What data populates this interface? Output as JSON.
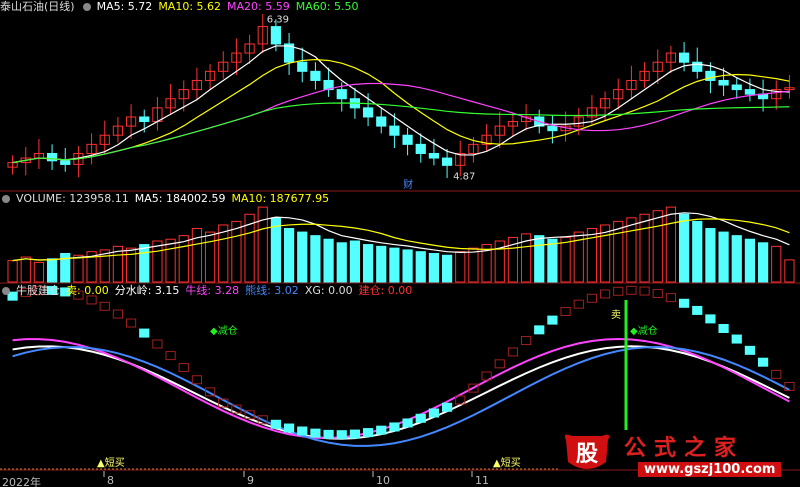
{
  "top_panel": {
    "title": "泰山石油(日线)",
    "ma": [
      {
        "label": "MA5: 5.72",
        "color": "#ffffff"
      },
      {
        "label": "MA10: 5.62",
        "color": "#ffff00"
      },
      {
        "label": "MA20: 5.59",
        "color": "#ff44ff"
      },
      {
        "label": "MA60: 5.50",
        "color": "#33ff33"
      }
    ],
    "high_marker": "6.39",
    "low_marker": "4.87",
    "event_marker": "财"
  },
  "volume_panel": {
    "labels": [
      {
        "label": "VOLUME: 123958.11",
        "color": "#dddddd"
      },
      {
        "label": "MA5: 184002.59",
        "color": "#ffffff"
      },
      {
        "label": "MA10: 187677.95",
        "color": "#ffff00"
      }
    ]
  },
  "indicator_panel": {
    "name": "牛股建仓",
    "values": [
      {
        "label": "卖: 0.00",
        "color": "#ffff00"
      },
      {
        "label": "分水岭: 3.15",
        "color": "#ffffff"
      },
      {
        "label": "牛线: 3.28",
        "color": "#ff44ff"
      },
      {
        "label": "熊线: 3.02",
        "color": "#4488ff"
      },
      {
        "label": "XG: 0.00",
        "color": "#dddddd"
      },
      {
        "label": "建仓: 0.00",
        "color": "#ff3333"
      }
    ],
    "signals": {
      "buy1": "▲短买",
      "buy2": "▲短买",
      "reduce1": "◆减仓",
      "reduce2": "◆减仓",
      "sell": "卖"
    }
  },
  "x_axis": {
    "labels": [
      "2022年",
      "8",
      "9",
      "10",
      "11"
    ]
  },
  "watermark": {
    "badge": "股",
    "text": "公式之家",
    "url": "www.gszj100.com"
  },
  "chart_data": [
    {
      "type": "candlestick",
      "title": "泰山石油(日线)",
      "high": 6.39,
      "low": 4.87,
      "close_series": [
        4.9,
        4.95,
        5.0,
        4.92,
        4.88,
        5.0,
        5.1,
        5.2,
        5.3,
        5.4,
        5.35,
        5.5,
        5.6,
        5.7,
        5.8,
        5.9,
        6.0,
        6.1,
        6.2,
        6.39,
        6.2,
        6.0,
        5.9,
        5.8,
        5.7,
        5.6,
        5.5,
        5.4,
        5.3,
        5.2,
        5.1,
        5.0,
        4.95,
        4.87,
        5.0,
        5.1,
        5.2,
        5.3,
        5.35,
        5.4,
        5.3,
        5.25,
        5.3,
        5.4,
        5.5,
        5.6,
        5.7,
        5.8,
        5.9,
        6.0,
        6.1,
        6.0,
        5.9,
        5.8,
        5.75,
        5.7,
        5.65,
        5.6,
        5.7,
        5.72
      ],
      "ma": {
        "MA5": 5.72,
        "MA10": 5.62,
        "MA20": 5.59,
        "MA60": 5.5
      }
    },
    {
      "type": "bar",
      "title": "VOLUME",
      "last_value": 123958.11,
      "ma": {
        "MA5": 184002.59,
        "MA10": 187677.95
      },
      "values": [
        120,
        140,
        110,
        130,
        160,
        150,
        170,
        180,
        200,
        190,
        210,
        230,
        240,
        260,
        300,
        280,
        320,
        340,
        380,
        420,
        360,
        300,
        280,
        260,
        240,
        220,
        230,
        210,
        200,
        190,
        180,
        170,
        160,
        150,
        170,
        190,
        210,
        230,
        250,
        270,
        260,
        240,
        250,
        280,
        300,
        320,
        340,
        360,
        380,
        400,
        420,
        380,
        340,
        300,
        280,
        260,
        240,
        220,
        200,
        124
      ]
    },
    {
      "type": "line",
      "title": "牛股建仓",
      "series": [
        {
          "name": "分水岭",
          "last": 3.15,
          "color": "#ffffff"
        },
        {
          "name": "牛线",
          "last": 3.28,
          "color": "#ff44ff"
        },
        {
          "name": "熊线",
          "last": 3.02,
          "color": "#4488ff"
        }
      ]
    }
  ]
}
